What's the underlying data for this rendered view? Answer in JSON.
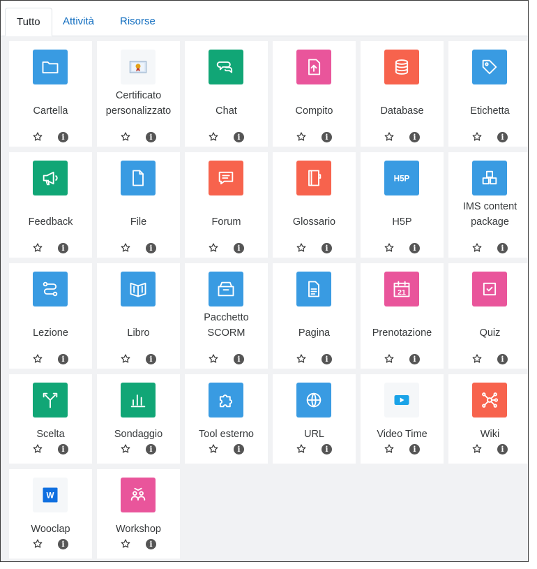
{
  "tabs": [
    {
      "label": "Tutto",
      "active": true
    },
    {
      "label": "Attività",
      "active": false
    },
    {
      "label": "Risorse",
      "active": false
    }
  ],
  "colors": {
    "blue": "#399be2",
    "green": "#11a676",
    "pink": "#e9559b",
    "red": "#f7634d",
    "link": "#0f6cbf"
  },
  "info_glyph": "i",
  "modules": [
    {
      "name": "Cartella",
      "icon": "folder-icon",
      "color": "blue"
    },
    {
      "name": "Certificato personalizzato",
      "icon": "certificate-icon",
      "color": "plain"
    },
    {
      "name": "Chat",
      "icon": "chat-icon",
      "color": "green"
    },
    {
      "name": "Compito",
      "icon": "assignment-icon",
      "color": "pink"
    },
    {
      "name": "Database",
      "icon": "database-icon",
      "color": "red"
    },
    {
      "name": "Etichetta",
      "icon": "tag-icon",
      "color": "blue"
    },
    {
      "name": "Feedback",
      "icon": "megaphone-icon",
      "color": "green"
    },
    {
      "name": "File",
      "icon": "file-icon",
      "color": "blue"
    },
    {
      "name": "Forum",
      "icon": "forum-icon",
      "color": "red"
    },
    {
      "name": "Glossario",
      "icon": "glossary-icon",
      "color": "red"
    },
    {
      "name": "H5P",
      "icon": "h5p-icon",
      "color": "blue"
    },
    {
      "name": "IMS content package",
      "icon": "package-icon",
      "color": "blue"
    },
    {
      "name": "Lezione",
      "icon": "lesson-icon",
      "color": "blue"
    },
    {
      "name": "Libro",
      "icon": "book-icon",
      "color": "blue"
    },
    {
      "name": "Pacchetto SCORM",
      "icon": "scorm-icon",
      "color": "blue"
    },
    {
      "name": "Pagina",
      "icon": "page-icon",
      "color": "blue"
    },
    {
      "name": "Prenotazione",
      "icon": "calendar-icon",
      "color": "pink"
    },
    {
      "name": "Quiz",
      "icon": "quiz-icon",
      "color": "pink"
    },
    {
      "name": "Scelta",
      "icon": "choice-icon",
      "color": "green"
    },
    {
      "name": "Sondaggio",
      "icon": "survey-icon",
      "color": "green"
    },
    {
      "name": "Tool esterno",
      "icon": "puzzle-icon",
      "color": "blue"
    },
    {
      "name": "URL",
      "icon": "globe-icon",
      "color": "blue"
    },
    {
      "name": "Video Time",
      "icon": "video-icon",
      "color": "plain"
    },
    {
      "name": "Wiki",
      "icon": "wiki-icon",
      "color": "red"
    },
    {
      "name": "Wooclap",
      "icon": "wooclap-icon",
      "color": "plain"
    },
    {
      "name": "Workshop",
      "icon": "workshop-icon",
      "color": "pink"
    }
  ],
  "calendar_day": "21",
  "h5p_text": "H5P",
  "wooclap_text": "W"
}
